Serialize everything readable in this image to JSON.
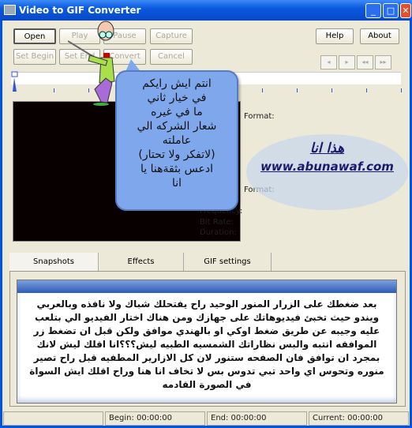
{
  "window": {
    "title": "Video to GIF Converter",
    "minimize": "_",
    "maximize": "□",
    "close": "✕"
  },
  "toolbar": {
    "open": "Open",
    "play": "Play",
    "pause": "Pause",
    "capture": "Capture",
    "help": "Help",
    "about": "About",
    "set_begin": "Set Begin",
    "set_end": "Set End",
    "convert": "Convert",
    "cancel": "Cancel"
  },
  "nav": {
    "prev": "◂",
    "next": "▸",
    "first": "◂◂",
    "last": "▸▸"
  },
  "info": {
    "video_format": "Format:",
    "audio_format": "Format:",
    "frequency": "Frequency:",
    "bit_rate": "Bit Rate:",
    "duration": "Duration:"
  },
  "watermark": {
    "line1": "هذا انا",
    "line2": "www.abunawaf.com"
  },
  "bubble": {
    "text": "انتم ايش رايكم\nفي خيار ثاني\nما في غيره\nشعار الشركه الي\nعاملته\n(لاتفكر ولا تحتار)\nادعس بثقةهنا يا\nانا"
  },
  "tabs": [
    {
      "label": "Snapshots"
    },
    {
      "label": "Effects"
    },
    {
      "label": "GIF settings"
    }
  ],
  "panel": {
    "text": "بعد ضغطك على الزرار المنور الوحيد راح يفتحلك شباك ولا نافذه وبالعربي ويندو حيث تخبئ فيديوهاتك على جهازك ومن هناك اختار الفيديو الي بتلعب عليه وجيبه عن طريق ضغط اوكي او بالهندي موافق ولكن قبل ان تضغط زر الموافقه انتبه والبس نظاراتك الشمسيه الطبيه ليش؟؟؟انا اقلك ليش لانك بمجرد ان توافق فان الصفحه ستنور لان كل الازارير المطفيه قبل راح تصير منوره وتحوس اي واحد تبي تدوس بس لا تخاف انا هنا وراح اقلك ايش السواة في الصورة القادمه"
  },
  "status": {
    "begin": "Begin: 00:00:00",
    "end": "End: 00:00:00",
    "current": "Current: 00:00:00"
  }
}
